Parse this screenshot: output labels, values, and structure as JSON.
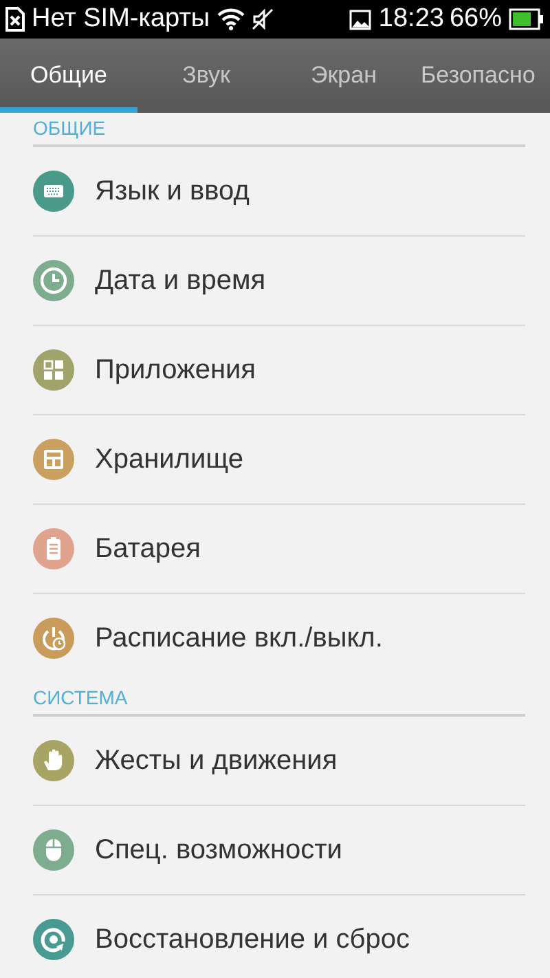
{
  "status_bar": {
    "carrier": "Нет SIM-карты",
    "time": "18:23",
    "battery": "66%"
  },
  "tabs": [
    {
      "label": "Общие",
      "selected": true
    },
    {
      "label": "Звук",
      "selected": false
    },
    {
      "label": "Экран",
      "selected": false
    },
    {
      "label": "Безопасно",
      "selected": false
    }
  ],
  "sections": [
    {
      "title": "ОБЩИЕ",
      "items": [
        {
          "label": "Язык и ввод",
          "kind": "keyboard",
          "color": "#4a9a8c"
        },
        {
          "label": "Дата и время",
          "kind": "clock",
          "color": "#7dac8e"
        },
        {
          "label": "Приложения",
          "kind": "apps",
          "color": "#a0a46a"
        },
        {
          "label": "Хранилище",
          "kind": "storage",
          "color": "#c9a060"
        },
        {
          "label": "Батарея",
          "kind": "battery",
          "color": "#e0a48e"
        },
        {
          "label": "Расписание вкл./выкл.",
          "kind": "schedule",
          "color": "#c99c5c"
        }
      ]
    },
    {
      "title": "СИСТЕМА",
      "items": [
        {
          "label": "Жесты и движения",
          "kind": "hand",
          "color": "#a8a464"
        },
        {
          "label": "Спец. возможности",
          "kind": "mouse",
          "color": "#7dac8e"
        },
        {
          "label": "Восстановление и сброс",
          "kind": "restore",
          "color": "#4a9a94"
        }
      ]
    }
  ]
}
